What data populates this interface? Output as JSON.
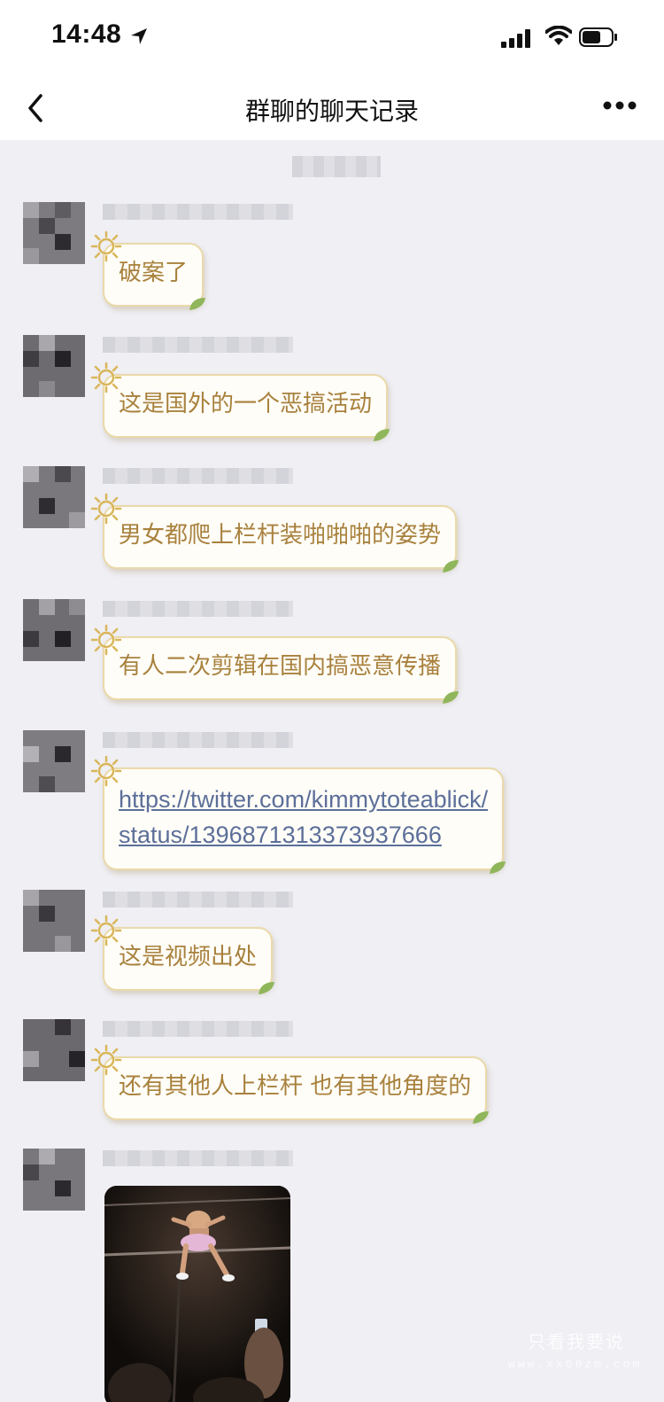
{
  "status_bar": {
    "time": "14:48",
    "icons": [
      "location-arrow-icon",
      "signal-icon",
      "wifi-icon",
      "battery-icon"
    ]
  },
  "nav": {
    "title": "群聊的聊天记录",
    "back_icon": "chevron-left-icon",
    "more_icon": "more-dots-icon"
  },
  "messages": [
    {
      "type": "text",
      "text": "破案了"
    },
    {
      "type": "text",
      "text": "这是国外的一个恶搞活动"
    },
    {
      "type": "text",
      "text": "男女都爬上栏杆装啪啪啪的姿势"
    },
    {
      "type": "text",
      "text": "有人二次剪辑在国内搞恶意传播"
    },
    {
      "type": "link",
      "lines": [
        "https://twitter.com/kimmytoteablick/",
        "status/1396871313373937666"
      ]
    },
    {
      "type": "text",
      "text": "这是视频出处"
    },
    {
      "type": "text",
      "text": "还有其他人上栏杆 也有其他角度的"
    },
    {
      "type": "image",
      "description_icon": "photo-thumbnail"
    }
  ],
  "watermark": {
    "text": "只看我要说",
    "url": "www.xx00zm.com"
  },
  "colors": {
    "chat_bg": "#efeff4",
    "bubble_bg": "#fffdf7",
    "bubble_border": "#ead9aa",
    "bubble_text": "#a8813d",
    "link_text": "#5c6f9a"
  }
}
